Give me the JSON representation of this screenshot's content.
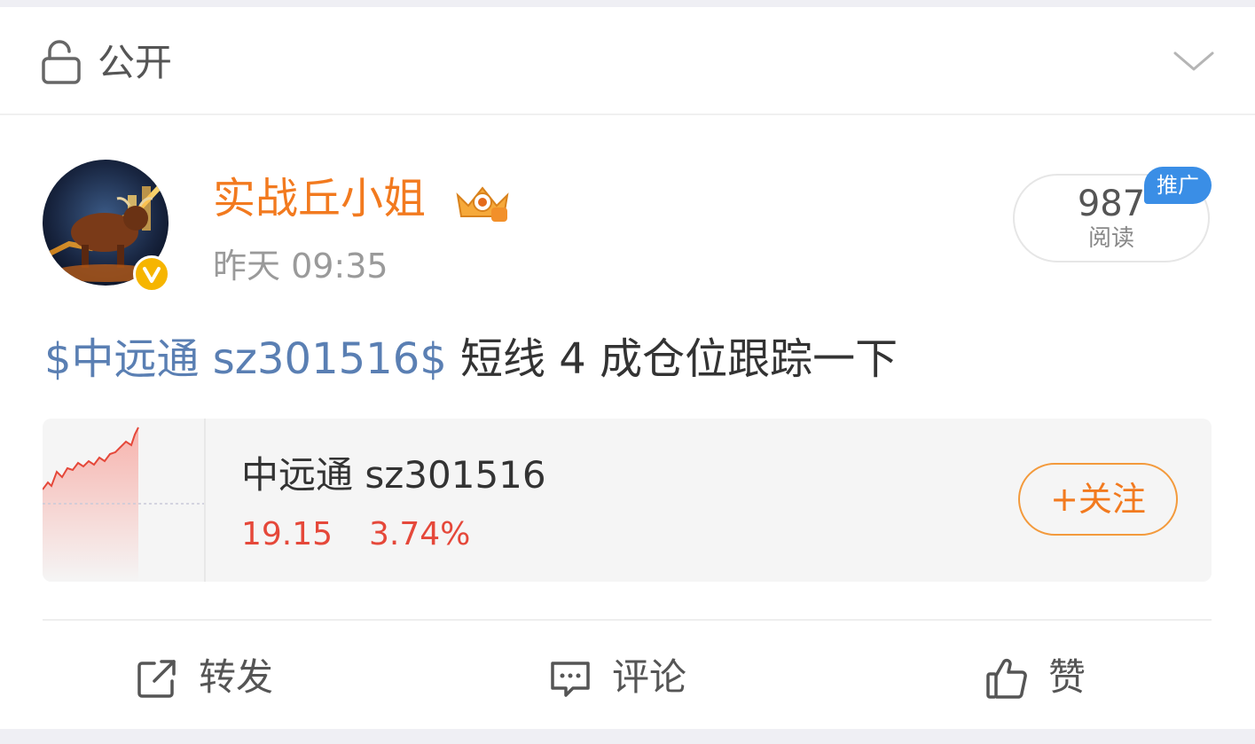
{
  "header": {
    "privacy_label": "公开",
    "lock_icon": "unlock-icon",
    "expand_icon": "chevron-down-icon"
  },
  "post": {
    "author": {
      "name": "实战丘小姐",
      "time": "昨天 09:35",
      "avatar": "bull-avatar",
      "verified_icon": "verified-v-icon",
      "level_icon": "crown-icon"
    },
    "reads": {
      "count": "987",
      "label": "阅读",
      "promo_badge": "推广"
    },
    "text": {
      "stock_tag": "$中远通 sz301516$",
      "body": " 短线 4 成仓位跟踪一下"
    },
    "stock_card": {
      "name": "中远通 sz301516",
      "price": "19.15",
      "change": "3.74%",
      "follow_label": "+关注",
      "price_color": "#e5483a"
    }
  },
  "actions": {
    "repost": "转发",
    "comment": "评论",
    "like": "赞"
  },
  "colors": {
    "accent": "#f27a1f",
    "link": "#5a7fb3",
    "promo": "#3a8ee6"
  }
}
